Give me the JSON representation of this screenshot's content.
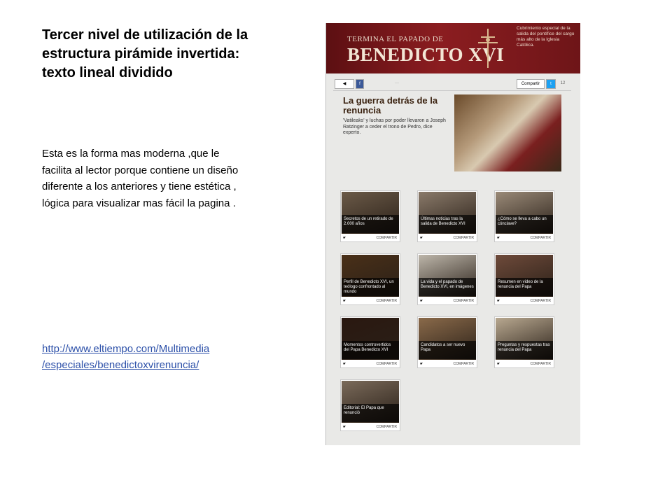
{
  "slide": {
    "title": "Tercer nivel de utilización de la estructura pirámide invertida: texto lineal dividido",
    "body": "Esta es la forma mas moderna ,que le facilita al lector porque contiene un diseño diferente a los anteriores  y tiene estética , lógica  para visualizar mas fácil  la pagina .",
    "link_line1": "http://www.eltiempo.com/Multimedia",
    "link_line2": "/especiales/benedictoxvirenuncia/"
  },
  "embed": {
    "banner_line1": "TERMINA EL PAPADO DE",
    "banner_line2": "BENEDICTO XVI",
    "banner_note": "Cubrimiento especial de la salida del pontífice del cargo más alto de la Iglesia Católica.",
    "toolbar": {
      "share": "Compartir",
      "count": "12"
    },
    "feature": {
      "headline": "La guerra detrás de la renuncia",
      "deck": "'Vatileaks' y luchas por poder llevaron a Joseph Ratzinger a ceder el trono de Pedro, dice experto."
    },
    "share_label": "COMPARTIR",
    "cards": [
      {
        "caption": "Secretos de un retirado de 2.000 años",
        "color": "#6b5a48"
      },
      {
        "caption": "Últimas noticias tras la salida de Benedicto XVI",
        "color": "#8a7a6a"
      },
      {
        "caption": "¿Cómo se lleva a cabo un cónclave?",
        "color": "#9a8a78"
      },
      {
        "caption": "Perfil de Benedicto XVI, un teólogo confrontado al mundo",
        "color": "#4a3018"
      },
      {
        "caption": "La vida y el papado de Benedicto XVI, en imágenes",
        "color": "#bdb6aa"
      },
      {
        "caption": "Resumen en video de la renuncia del Papa",
        "color": "#6e4a3a"
      },
      {
        "caption": "Momentos controvertidos del Papa Benedicto XVI",
        "color": "#2a1810"
      },
      {
        "caption": "Candidatos a ser nuevo Papa",
        "color": "#8a6a4a"
      },
      {
        "caption": "Preguntas y respuestas tras renuncia del Papa",
        "color": "#b8a890"
      },
      {
        "caption": "Editorial: El Papa que renunció",
        "color": "#7a6a5a"
      }
    ]
  }
}
